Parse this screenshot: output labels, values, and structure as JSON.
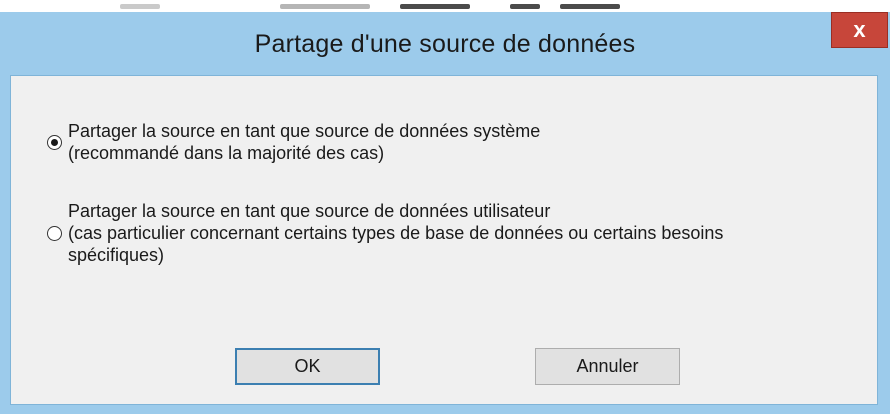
{
  "dialog": {
    "title": "Partage d'une source de données",
    "close_label": "x"
  },
  "options": [
    {
      "line1": "Partager la source en tant que source de données système",
      "line2": "(recommandé dans la majorité des cas)",
      "line3": "",
      "selected": true
    },
    {
      "line1": "Partager la source en tant que source de données utilisateur",
      "line2": "(cas particulier concernant certains types de base de données ou certains besoins",
      "line3": "spécifiques)",
      "selected": false
    }
  ],
  "buttons": {
    "ok_label": "OK",
    "cancel_label": "Annuler"
  },
  "colors": {
    "frame": "#9ccbeb",
    "close": "#c7463a",
    "client": "#f0f0f0"
  }
}
